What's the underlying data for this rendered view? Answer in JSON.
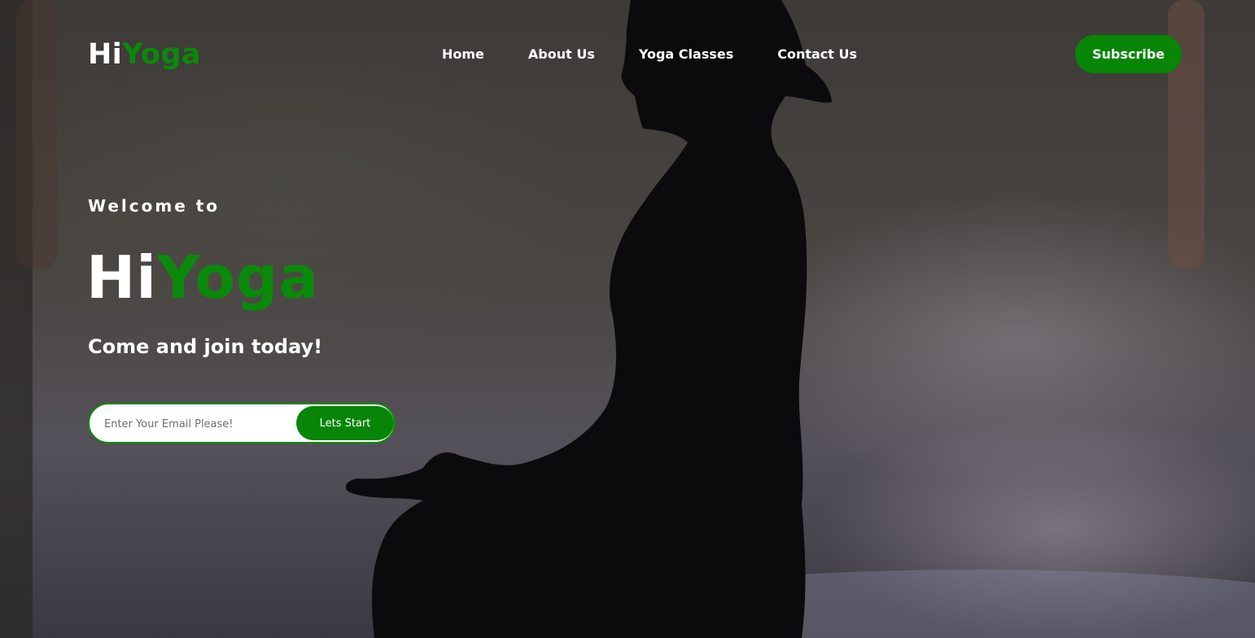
{
  "brand": {
    "part1": "Hi",
    "part2": "Yoga"
  },
  "nav": {
    "links": [
      "Home",
      "About Us",
      "Yoga Classes",
      "Contact Us"
    ],
    "subscribe_label": "Subscribe"
  },
  "hero": {
    "welcome": "Welcome to",
    "title_part1": "Hi",
    "title_part2": "Yoga",
    "tagline": "Come and join today!",
    "email_placeholder": "Enter Your Email Please!",
    "cta_label": "Lets Start"
  },
  "colors": {
    "brand_green": "#078507",
    "text_white": "#ffffff"
  },
  "background": {
    "subject": "silhouette of a woman meditating in lotus pose"
  }
}
